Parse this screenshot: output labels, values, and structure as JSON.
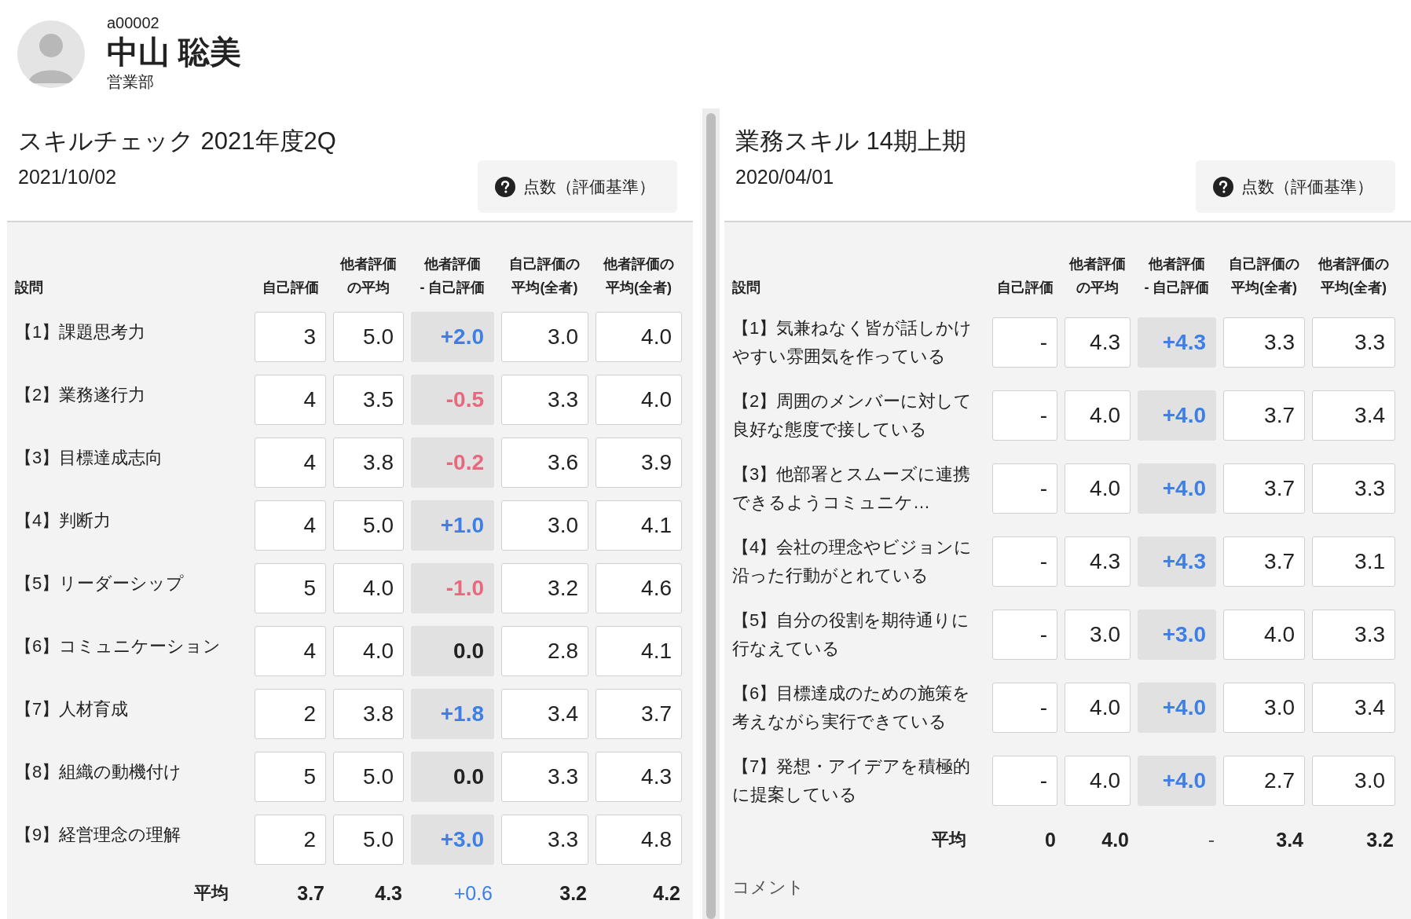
{
  "profile": {
    "employee_id": "a00002",
    "name": "中山 聡美",
    "department": "営業部"
  },
  "panels": [
    {
      "title": "スキルチェック 2021年度2Q",
      "date": "2021/10/02",
      "criteria_button": "点数（評価基準）",
      "columns": [
        "設問",
        "自己評価",
        "他者評価の平均",
        "他者評価\n- 自己評価",
        "自己評価の平均(全者)",
        "他者評価の平均(全者)"
      ],
      "rows": [
        {
          "question": "【1】課題思考力",
          "self": "3",
          "others_avg": "5.0",
          "diff": "+2.0",
          "color": "#3d7fe6",
          "self_all": "3.0",
          "others_all": "4.0"
        },
        {
          "question": "【2】業務遂行力",
          "self": "4",
          "others_avg": "3.5",
          "diff": "-0.5",
          "color": "#e8687e",
          "self_all": "3.3",
          "others_all": "4.0"
        },
        {
          "question": "【3】目標達成志向",
          "self": "4",
          "others_avg": "3.8",
          "diff": "-0.2",
          "color": "#e8687e",
          "self_all": "3.6",
          "others_all": "3.9"
        },
        {
          "question": "【4】判断力",
          "self": "4",
          "others_avg": "5.0",
          "diff": "+1.0",
          "color": "#3d7fe6",
          "self_all": "3.0",
          "others_all": "4.1"
        },
        {
          "question": "【5】リーダーシップ",
          "self": "5",
          "others_avg": "4.0",
          "diff": "-1.0",
          "color": "#e8687e",
          "self_all": "3.2",
          "others_all": "4.6"
        },
        {
          "question": "【6】コミュニケーション",
          "self": "4",
          "others_avg": "4.0",
          "diff": "0.0",
          "color": "#222222",
          "self_all": "2.8",
          "others_all": "4.1"
        },
        {
          "question": "【7】人材育成",
          "self": "2",
          "others_avg": "3.8",
          "diff": "+1.8",
          "color": "#3d7fe6",
          "self_all": "3.4",
          "others_all": "3.7"
        },
        {
          "question": "【8】組織の動機付け",
          "self": "5",
          "others_avg": "5.0",
          "diff": "0.0",
          "color": "#222222",
          "self_all": "3.3",
          "others_all": "4.3"
        },
        {
          "question": "【9】経営理念の理解",
          "self": "2",
          "others_avg": "5.0",
          "diff": "+3.0",
          "color": "#3d7fe6",
          "self_all": "3.3",
          "others_all": "4.8"
        }
      ],
      "average": {
        "label": "平均",
        "self": "3.7",
        "others_avg": "4.3",
        "diff": "+0.6",
        "color": "#3d7fe6",
        "self_all": "3.2",
        "others_all": "4.2"
      }
    },
    {
      "title": "業務スキル 14期上期",
      "date": "2020/04/01",
      "criteria_button": "点数（評価基準）",
      "columns": [
        "設問",
        "自己評価",
        "他者評価の平均",
        "他者評価\n- 自己評価",
        "自己評価の平均(全者)",
        "他者評価の平均(全者)"
      ],
      "rows": [
        {
          "question": "【1】気兼ねなく皆が話しかけやすい雰囲気を作っている",
          "self": "-",
          "others_avg": "4.3",
          "diff": "+4.3",
          "color": "#3d7fe6",
          "self_all": "3.3",
          "others_all": "3.3"
        },
        {
          "question": "【2】周囲のメンバーに対して良好な態度で接している",
          "self": "-",
          "others_avg": "4.0",
          "diff": "+4.0",
          "color": "#3d7fe6",
          "self_all": "3.7",
          "others_all": "3.4"
        },
        {
          "question": "【3】他部署とスムーズに連携できるようコミュニケ…",
          "self": "-",
          "others_avg": "4.0",
          "diff": "+4.0",
          "color": "#3d7fe6",
          "self_all": "3.7",
          "others_all": "3.3"
        },
        {
          "question": "【4】会社の理念やビジョンに沿った行動がとれている",
          "self": "-",
          "others_avg": "4.3",
          "diff": "+4.3",
          "color": "#3d7fe6",
          "self_all": "3.7",
          "others_all": "3.1"
        },
        {
          "question": "【5】自分の役割を期待通りに行なえている",
          "self": "-",
          "others_avg": "3.0",
          "diff": "+3.0",
          "color": "#3d7fe6",
          "self_all": "4.0",
          "others_all": "3.3"
        },
        {
          "question": "【6】目標達成のための施策を考えながら実行できている",
          "self": "-",
          "others_avg": "4.0",
          "diff": "+4.0",
          "color": "#3d7fe6",
          "self_all": "3.0",
          "others_all": "3.4"
        },
        {
          "question": "【7】発想・アイデアを積極的に提案している",
          "self": "-",
          "others_avg": "4.0",
          "diff": "+4.0",
          "color": "#3d7fe6",
          "self_all": "2.7",
          "others_all": "3.0"
        }
      ],
      "average": {
        "label": "平均",
        "self": "0",
        "others_avg": "4.0",
        "diff": "-",
        "color": "#555555",
        "self_all": "3.4",
        "others_all": "3.2"
      },
      "comment_label": "コメント"
    }
  ]
}
